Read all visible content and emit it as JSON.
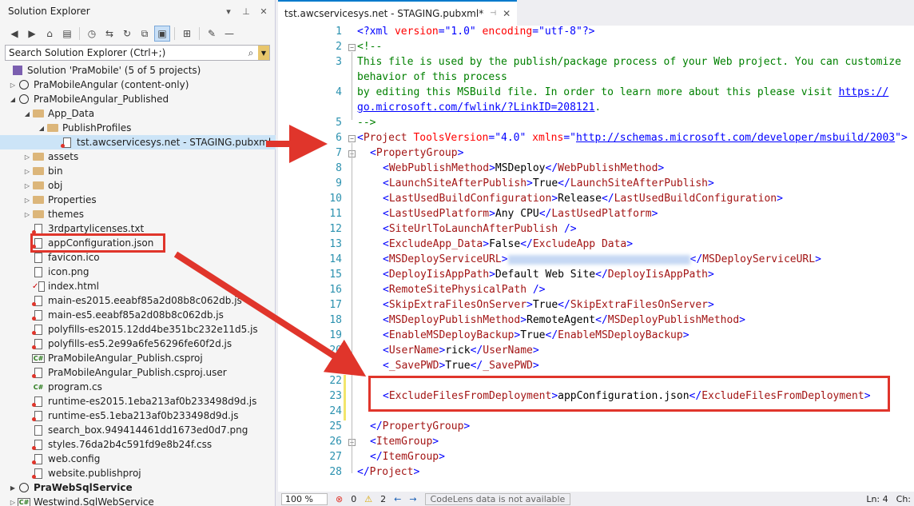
{
  "solution_explorer": {
    "title": "Solution Explorer",
    "search_placeholder": "Search Solution Explorer (Ctrl+;)",
    "items": [
      {
        "label": "Solution 'PraMobile' (5 of 5 projects)"
      },
      {
        "label": "PraMobileAngular (content-only)"
      },
      {
        "label": "PraMobileAngular_Published"
      },
      {
        "label": "App_Data"
      },
      {
        "label": "PublishProfiles"
      },
      {
        "label": "tst.awcservicesys.net - STAGING.pubxml"
      },
      {
        "label": "assets"
      },
      {
        "label": "bin"
      },
      {
        "label": "obj"
      },
      {
        "label": "Properties"
      },
      {
        "label": "themes"
      },
      {
        "label": "3rdpartylicenses.txt"
      },
      {
        "label": "appConfiguration.json"
      },
      {
        "label": "favicon.ico"
      },
      {
        "label": "icon.png"
      },
      {
        "label": "index.html"
      },
      {
        "label": "main-es2015.eeabf85a2d08b8c062db.js"
      },
      {
        "label": "main-es5.eeabf85a2d08b8c062db.js"
      },
      {
        "label": "polyfills-es2015.12dd4be351bc232e11d5.js"
      },
      {
        "label": "polyfills-es5.2e99a6fe56296fe60f2d.js"
      },
      {
        "label": "PraMobileAngular_Publish.csproj"
      },
      {
        "label": "PraMobileAngular_Publish.csproj.user"
      },
      {
        "label": "program.cs"
      },
      {
        "label": "runtime-es2015.1eba213af0b233498d9d.js"
      },
      {
        "label": "runtime-es5.1eba213af0b233498d9d.js"
      },
      {
        "label": "search_box.949414461dd1673ed0d7.png"
      },
      {
        "label": "styles.76da2b4c591fd9e8b24f.css"
      },
      {
        "label": "web.config"
      },
      {
        "label": "website.publishproj"
      },
      {
        "label": "PraWebSqlService"
      },
      {
        "label": "Westwind.SqlWebService"
      }
    ]
  },
  "editor": {
    "tab_title": "tst.awcservicesys.net - STAGING.pubxml*",
    "line_numbers": [
      "1",
      "2",
      "3",
      "",
      "4",
      "",
      "5",
      "6",
      "7",
      "8",
      "9",
      "10",
      "11",
      "12",
      "13",
      "14",
      "15",
      "16",
      "17",
      "18",
      "19",
      "20",
      "21",
      "22",
      "23",
      "24",
      "25",
      "26",
      "27",
      "28"
    ],
    "lines": {
      "l1a": "<?xml ",
      "l1b": "version",
      "l1c": "=\"1.0\"",
      "l1d": " encoding",
      "l1e": "=\"utf-8\"",
      "l1f": "?>",
      "l2": "<!--",
      "l3a": "This file is used by the publish/package process of your Web project. You can customize",
      "l3b": " behavior of this process",
      "l4a": "by editing this MSBuild file. In order to learn more about this please visit ",
      "l4b": "https://",
      "l4c": " go.microsoft.com/fwlink/?LinkID=208121",
      "l4d": ".",
      "l5": "-->",
      "l6a": "<",
      "l6b": "Project",
      "l6c": " ToolsVersion",
      "l6d": "=\"4.0\"",
      "l6e": " xmlns",
      "l6f": "=\"",
      "l6g": "http://schemas.microsoft.com/developer/msbuild/2003",
      "l6h": "\">",
      "pg_open": "PropertyGroup",
      "t7": "WebPublishMethod",
      "v7": "MSDeploy",
      "t8": "LaunchSiteAfterPublish",
      "v8": "True",
      "t9": "LastUsedBuildConfiguration",
      "v9": "Release",
      "t10": "LastUsedPlatform",
      "v10": "Any CPU",
      "t11": "SiteUrlToLaunchAfterPublish",
      "t12": "ExcludeApp_Data",
      "v12": "False",
      "t12c": "ExcludeApp Data",
      "t13": "MSDeployServiceURL",
      "t14": "DeployIisAppPath",
      "v14": "Default Web Site",
      "t15": "RemoteSitePhysicalPath",
      "t16": "SkipExtraFilesOnServer",
      "v16": "True",
      "t17": "MSDeployPublishMethod",
      "v17": "RemoteAgent",
      "t18": "EnableMSDeployBackup",
      "v18": "True",
      "t19": "UserName",
      "v19": "rick",
      "t20": "_SavePWD",
      "v20": "True",
      "t23": "ExcludeFilesFromDeployment",
      "v23": "appConfiguration.json",
      "ig": "ItemGroup",
      "proj": "Project"
    }
  },
  "status_bar": {
    "zoom": "100 %",
    "errors": "0",
    "warnings": "2",
    "codelens": "CodeLens data is not available",
    "line": "Ln: 4",
    "col": "Ch:"
  },
  "colors": {
    "accent": "#007acc",
    "highlight_red": "#e0352b"
  }
}
